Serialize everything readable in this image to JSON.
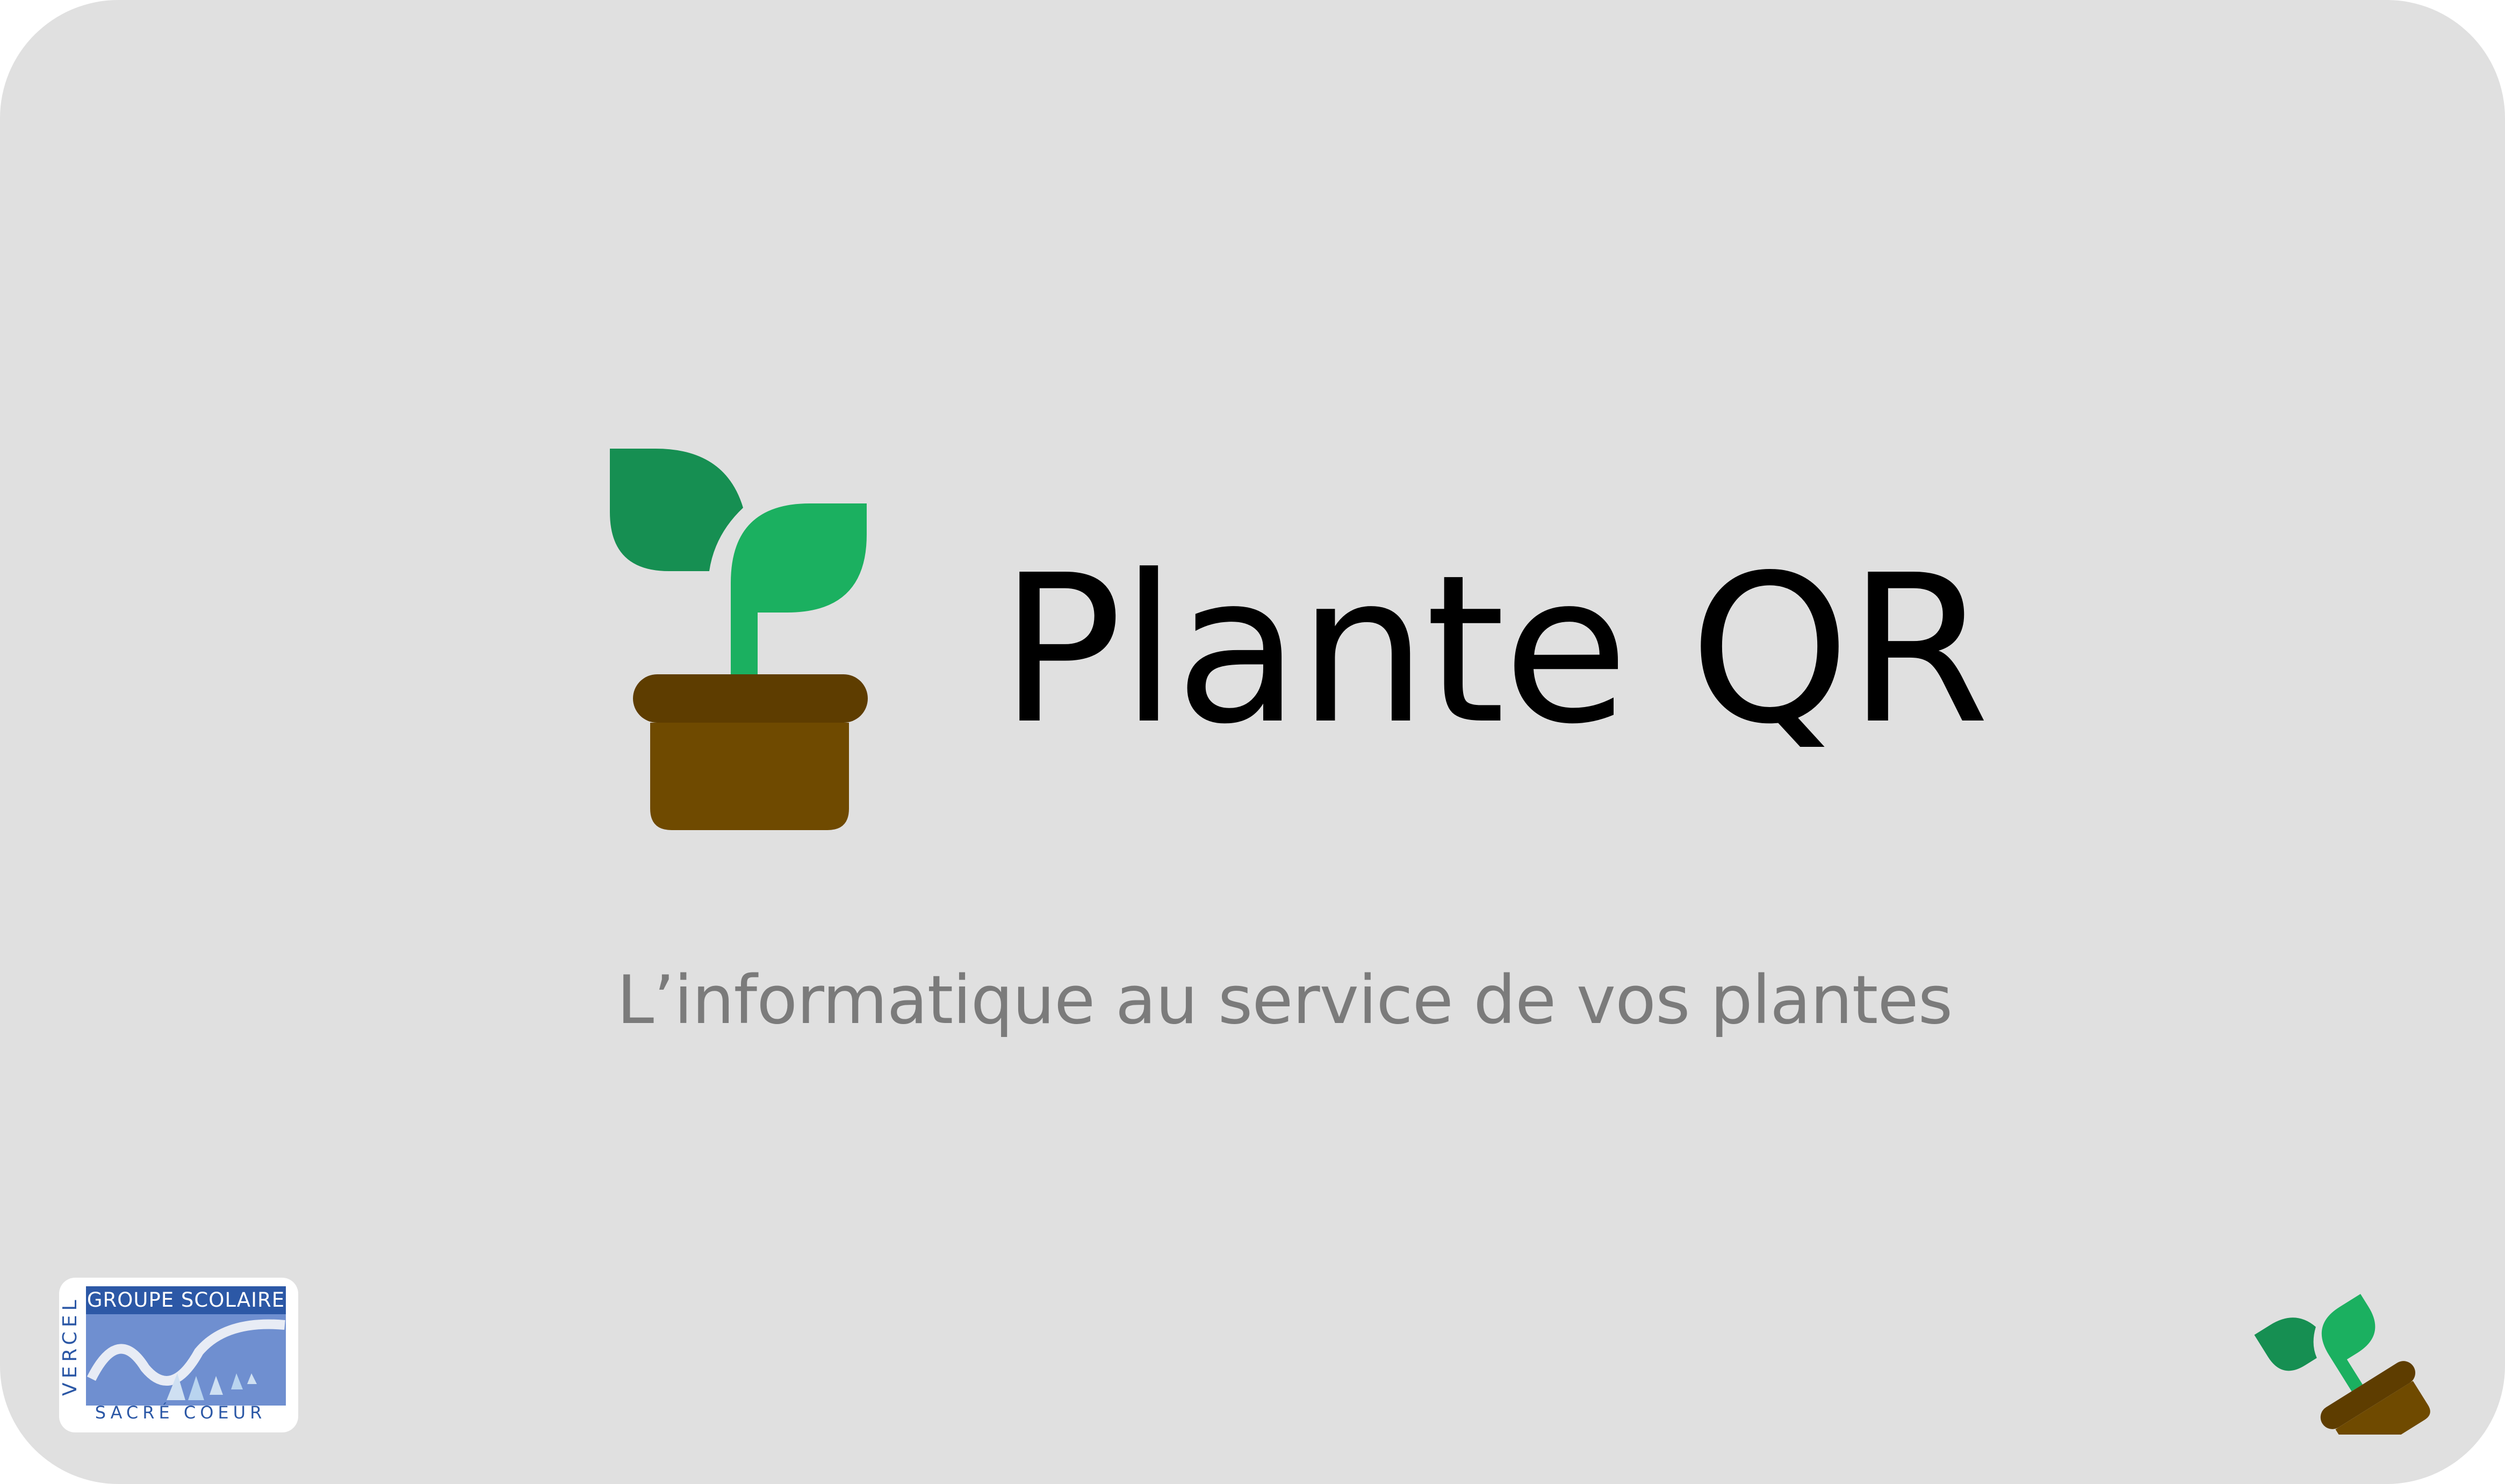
{
  "app": {
    "title": "Plante QR",
    "tagline": "L’informatique au service de vos plantes"
  },
  "school_logo": {
    "line1": "GROUPE SCOLAIRE",
    "side": "VERCEL",
    "bottom": "SACRÉ COEUR"
  },
  "icons": {
    "main": "potted-sprout-icon",
    "corner": "tilted-potted-sprout-icon"
  },
  "colors": {
    "background": "#e0e0e0",
    "leaf_dark": "#168f52",
    "leaf_light": "#1bb060",
    "stem": "#1bb060",
    "pot_rim": "#5e3d00",
    "pot_body": "#6f4a00",
    "title": "#000000",
    "tagline": "#7b7b7b",
    "school_blue": "#2c58a6",
    "school_light": "#6f8fd0"
  }
}
